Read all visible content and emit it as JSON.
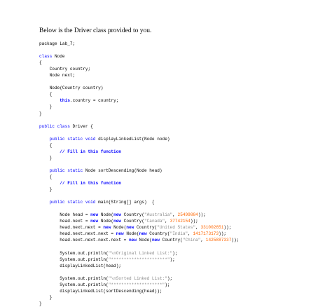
{
  "heading": "Below is the Driver class provided to you.",
  "colors": {
    "keyword": "#0000ff",
    "comment": "#0000ff",
    "string": "#8a8a8a",
    "number": "#ff6600",
    "text": "#000000"
  },
  "code_lines": [
    [
      {
        "t": "package Lab_7;",
        "c": "plain"
      }
    ],
    [],
    [
      {
        "t": "class",
        "c": "kw"
      },
      {
        "t": " Node",
        "c": "plain"
      }
    ],
    [
      {
        "t": "{",
        "c": "plain"
      }
    ],
    [
      {
        "t": "    Country country;",
        "c": "plain"
      }
    ],
    [
      {
        "t": "    Node next;",
        "c": "plain"
      }
    ],
    [],
    [
      {
        "t": "    Node(Country country)",
        "c": "plain"
      }
    ],
    [
      {
        "t": "    {",
        "c": "plain"
      }
    ],
    [
      {
        "t": "        ",
        "c": "plain"
      },
      {
        "t": "this",
        "c": "kwb"
      },
      {
        "t": ".country = country;",
        "c": "plain"
      }
    ],
    [
      {
        "t": "    }",
        "c": "plain"
      }
    ],
    [
      {
        "t": "}",
        "c": "plain"
      }
    ],
    [],
    [
      {
        "t": "public class",
        "c": "kw"
      },
      {
        "t": " Driver {",
        "c": "plain"
      }
    ],
    [],
    [
      {
        "t": "    ",
        "c": "plain"
      },
      {
        "t": "public static void",
        "c": "kw"
      },
      {
        "t": " displayLinkedList(Node node)",
        "c": "plain"
      }
    ],
    [
      {
        "t": "    {",
        "c": "plain"
      }
    ],
    [
      {
        "t": "        // Fill in this function",
        "c": "cm"
      }
    ],
    [
      {
        "t": "    }",
        "c": "plain"
      }
    ],
    [],
    [
      {
        "t": "    ",
        "c": "plain"
      },
      {
        "t": "public static",
        "c": "kw"
      },
      {
        "t": " Node sortDescending(Node head)",
        "c": "plain"
      }
    ],
    [
      {
        "t": "    {",
        "c": "plain"
      }
    ],
    [
      {
        "t": "        // Fill in this function",
        "c": "cm"
      }
    ],
    [
      {
        "t": "    }",
        "c": "plain"
      }
    ],
    [],
    [
      {
        "t": "    ",
        "c": "plain"
      },
      {
        "t": "public static void",
        "c": "kw"
      },
      {
        "t": " main(String[] args)  {",
        "c": "plain"
      }
    ],
    [],
    [
      {
        "t": "        Node head = ",
        "c": "plain"
      },
      {
        "t": "new",
        "c": "kwb"
      },
      {
        "t": " Node(",
        "c": "plain"
      },
      {
        "t": "new",
        "c": "kwb"
      },
      {
        "t": " Country(",
        "c": "plain"
      },
      {
        "t": "\"Australia\"",
        "c": "str"
      },
      {
        "t": ", ",
        "c": "plain"
      },
      {
        "t": "25499884",
        "c": "num"
      },
      {
        "t": "));",
        "c": "plain"
      }
    ],
    [
      {
        "t": "        head.next = ",
        "c": "plain"
      },
      {
        "t": "new",
        "c": "kwb"
      },
      {
        "t": " Node(",
        "c": "plain"
      },
      {
        "t": "new",
        "c": "kwb"
      },
      {
        "t": " Country(",
        "c": "plain"
      },
      {
        "t": "\"Canada\"",
        "c": "str"
      },
      {
        "t": ", ",
        "c": "plain"
      },
      {
        "t": "37742154",
        "c": "num"
      },
      {
        "t": "));",
        "c": "plain"
      }
    ],
    [
      {
        "t": "        head.next.next = ",
        "c": "plain"
      },
      {
        "t": "new",
        "c": "kwb"
      },
      {
        "t": " Node(",
        "c": "plain"
      },
      {
        "t": "new",
        "c": "kwb"
      },
      {
        "t": " Country(",
        "c": "plain"
      },
      {
        "t": "\"United States\"",
        "c": "str"
      },
      {
        "t": ", ",
        "c": "plain"
      },
      {
        "t": "331002651",
        "c": "num"
      },
      {
        "t": "));",
        "c": "plain"
      }
    ],
    [
      {
        "t": "        head.next.next.next = ",
        "c": "plain"
      },
      {
        "t": "new",
        "c": "kwb"
      },
      {
        "t": " Node(",
        "c": "plain"
      },
      {
        "t": "new",
        "c": "kwb"
      },
      {
        "t": " Country(",
        "c": "plain"
      },
      {
        "t": "\"India\"",
        "c": "str"
      },
      {
        "t": ", ",
        "c": "plain"
      },
      {
        "t": "1417173173",
        "c": "num"
      },
      {
        "t": "));",
        "c": "plain"
      }
    ],
    [
      {
        "t": "        head.next.next.next.next = ",
        "c": "plain"
      },
      {
        "t": "new",
        "c": "kwb"
      },
      {
        "t": " Node(",
        "c": "plain"
      },
      {
        "t": "new",
        "c": "kwb"
      },
      {
        "t": " Country(",
        "c": "plain"
      },
      {
        "t": "\"China\"",
        "c": "str"
      },
      {
        "t": ", ",
        "c": "plain"
      },
      {
        "t": "1425887337",
        "c": "num"
      },
      {
        "t": "));",
        "c": "plain"
      }
    ],
    [],
    [
      {
        "t": "        System.out.println(",
        "c": "plain"
      },
      {
        "t": "\"\\nOriginal Linked List:\"",
        "c": "str"
      },
      {
        "t": ");",
        "c": "plain"
      }
    ],
    [
      {
        "t": "        System.out.println(",
        "c": "plain"
      },
      {
        "t": "\"**********************\"",
        "c": "str"
      },
      {
        "t": ");",
        "c": "plain"
      }
    ],
    [
      {
        "t": "        displayLinkedList(head);",
        "c": "plain"
      }
    ],
    [],
    [
      {
        "t": "        System.out.println(",
        "c": "plain"
      },
      {
        "t": "\"\\nSorted Linked List:\"",
        "c": "str"
      },
      {
        "t": ");",
        "c": "plain"
      }
    ],
    [
      {
        "t": "        System.out.println(",
        "c": "plain"
      },
      {
        "t": "\"********************\"",
        "c": "str"
      },
      {
        "t": ");",
        "c": "plain"
      }
    ],
    [
      {
        "t": "        displayLinkedList(sortDescending(head));",
        "c": "plain"
      }
    ],
    [
      {
        "t": "    }",
        "c": "plain"
      }
    ],
    [
      {
        "t": "}",
        "c": "plain"
      }
    ]
  ]
}
